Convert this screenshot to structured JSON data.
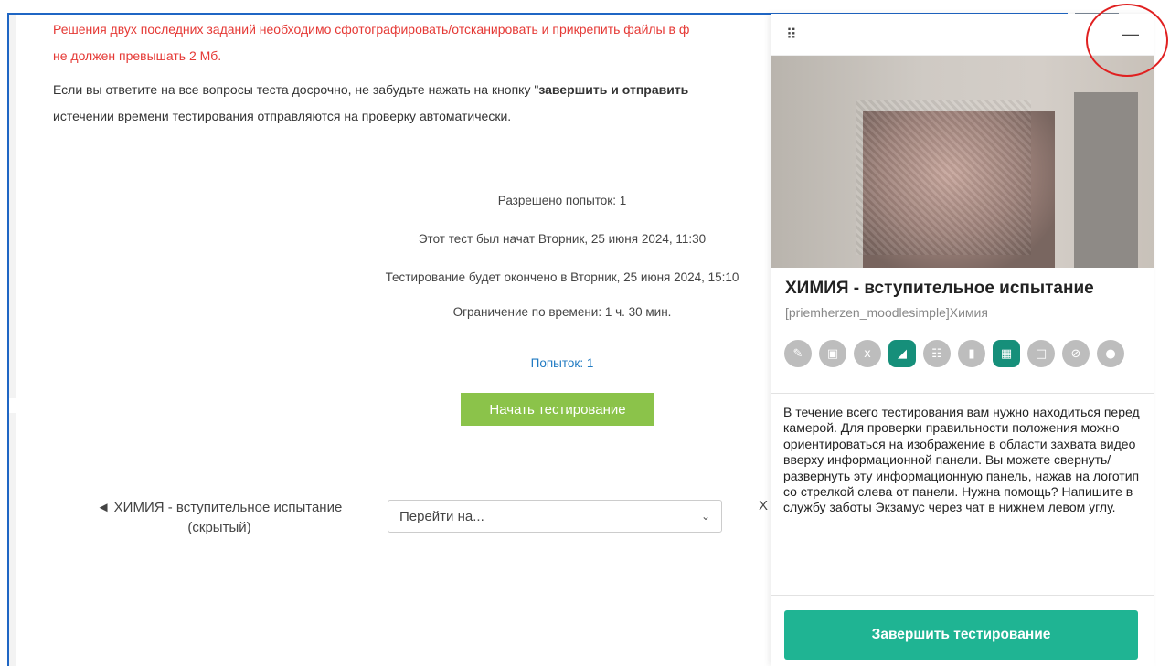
{
  "page": {
    "warning_line1": "Решения двух последних заданий необходимо сфотографировать/отсканировать и прикрепить файлы в ф",
    "warning_line2": "не должен превышать 2 Мб.",
    "info_line1_prefix": "Если вы ответите на все вопросы теста досрочно, не забудьте нажать на кнопку \"",
    "info_line1_bold": "завершить и отправить",
    "info_line2": "истечении времени тестирования отправляются на проверку автоматически.",
    "attempts_allowed": "Разрешено попыток: 1",
    "started_at": "Этот тест был начат Вторник, 25 июня 2024, 11:30",
    "ends_at": "Тестирование будет окончено в Вторник, 25 июня 2024, 15:10",
    "time_limit": "Ограничение по времени: 1 ч. 30 мин.",
    "attempts_link": "Попыток: 1",
    "start_button": "Начать тестирование",
    "prev_activity": "◄ ХИМИЯ - вступительное испытание (скрытый)",
    "jump_placeholder": "Перейти на...",
    "next_peek": "Х"
  },
  "panel": {
    "drag_icon": "⠿",
    "minimize_icon": "—",
    "title": "ХИМИЯ - вступительное испытание",
    "subtitle": "[priemherzen_moodlesimple]Химия",
    "icons": [
      "megaphone-icon",
      "book-icon",
      "excel-icon",
      "edit-icon",
      "globe-icon",
      "exit-icon",
      "grid-icon",
      "chat-icon",
      "hidden-icon",
      "user-icon"
    ],
    "description": "В течение всего тестирования вам нужно находиться перед камерой. Для проверки правильности положения можно ориентироваться на изображение в области захвата видео вверху информационной панели. Вы можете свернуть/развернуть эту информационную панель, нажав на логотип со стрелкой слева от панели. Нужна помощь? Напишите в службу заботы Экзамус через чат в нижнем левом углу.",
    "finish_button": "Завершить тестирование"
  },
  "colors": {
    "warning": "#e53935",
    "start_button": "#8bc34a",
    "finish_button": "#1fb493",
    "link": "#1f7ac2",
    "active_icon": "#168f7a"
  }
}
